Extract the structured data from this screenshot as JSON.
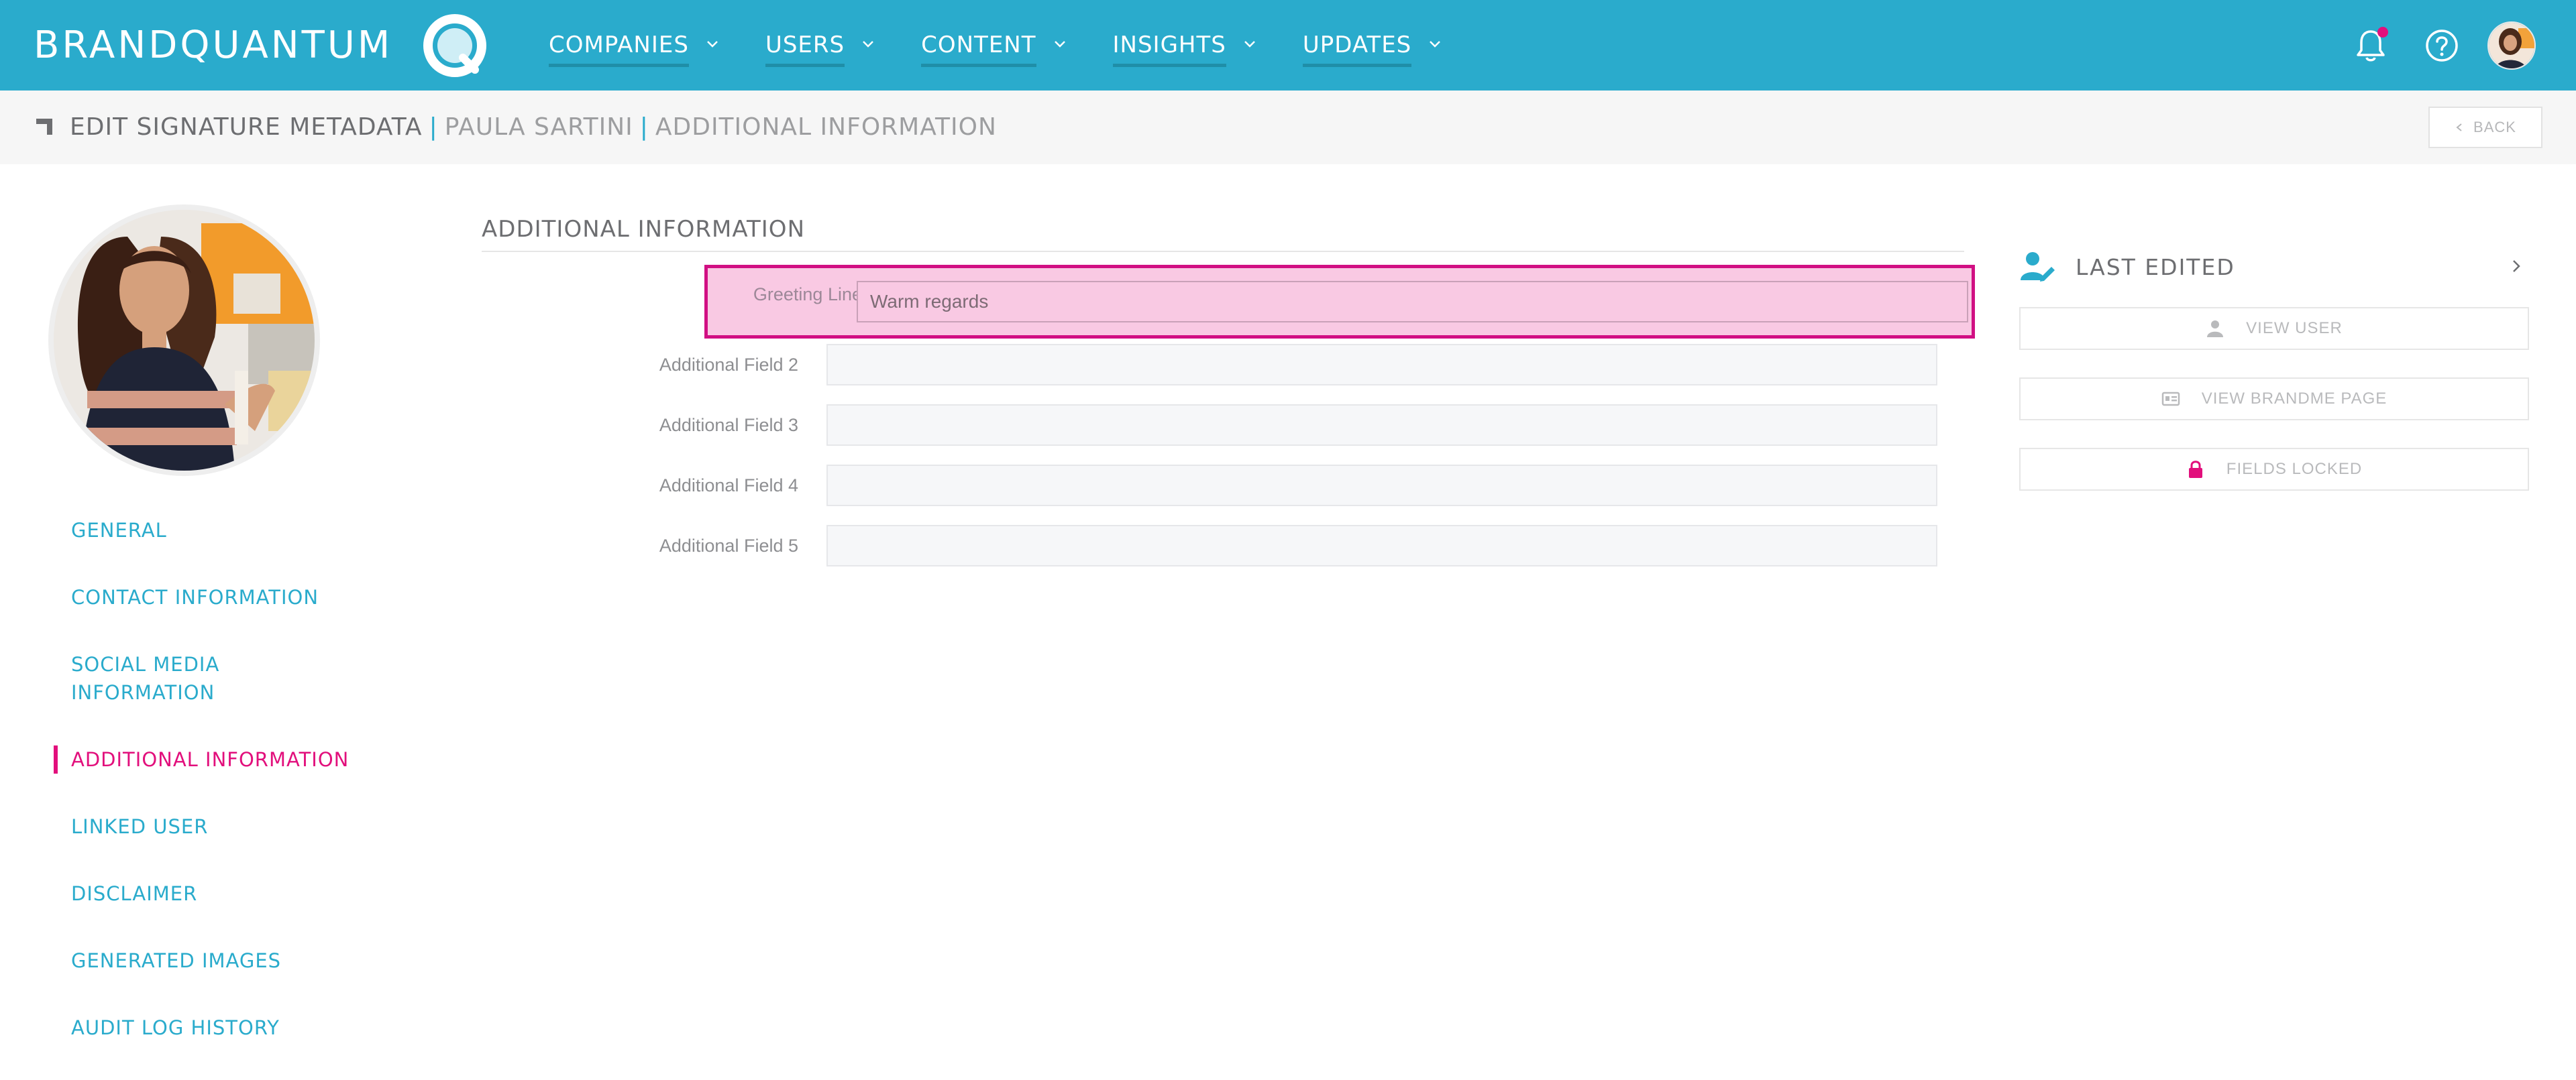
{
  "brand": {
    "name": "BRANDQUANTUM"
  },
  "nav": {
    "items": [
      {
        "label": "COMPANIES"
      },
      {
        "label": "USERS"
      },
      {
        "label": "CONTENT"
      },
      {
        "label": "INSIGHTS"
      },
      {
        "label": "UPDATES"
      }
    ],
    "icons": [
      "bell-icon",
      "help-icon",
      "user-avatar"
    ]
  },
  "breadcrumb": {
    "title": "EDIT SIGNATURE METADATA",
    "separator": "|",
    "name": "PAULA SARTINI",
    "section": "ADDITIONAL INFORMATION"
  },
  "back_button": {
    "label": "BACK"
  },
  "sidebar": {
    "items": [
      {
        "label": "GENERAL"
      },
      {
        "label": "CONTACT INFORMATION"
      },
      {
        "label": "SOCIAL MEDIA INFORMATION",
        "line1": "SOCIAL MEDIA",
        "line2": "INFORMATION"
      },
      {
        "label": "ADDITIONAL INFORMATION",
        "active": true
      },
      {
        "label": "LINKED USER"
      },
      {
        "label": "DISCLAIMER"
      },
      {
        "label": "GENERATED IMAGES"
      },
      {
        "label": "AUDIT LOG HISTORY"
      }
    ]
  },
  "form": {
    "title": "ADDITIONAL INFORMATION",
    "fields": [
      {
        "label": "Greeting Line",
        "value": "Warm regards"
      },
      {
        "label": "Additional Field 2",
        "value": ""
      },
      {
        "label": "Additional Field 3",
        "value": ""
      },
      {
        "label": "Additional Field 4",
        "value": ""
      },
      {
        "label": "Additional Field 5",
        "value": ""
      }
    ]
  },
  "right_panel": {
    "last_edited": "LAST EDITED",
    "buttons": [
      {
        "label": "VIEW USER",
        "icon": "person-icon"
      },
      {
        "label": "VIEW BRANDME PAGE",
        "icon": "id-card-icon"
      },
      {
        "label": "FIELDS LOCKED",
        "icon": "lock-icon"
      }
    ]
  },
  "colors": {
    "nav_bg": "#2aabcc",
    "accent": "#2aabcc",
    "active": "#e20f7c",
    "highlight": "#d10f83"
  }
}
